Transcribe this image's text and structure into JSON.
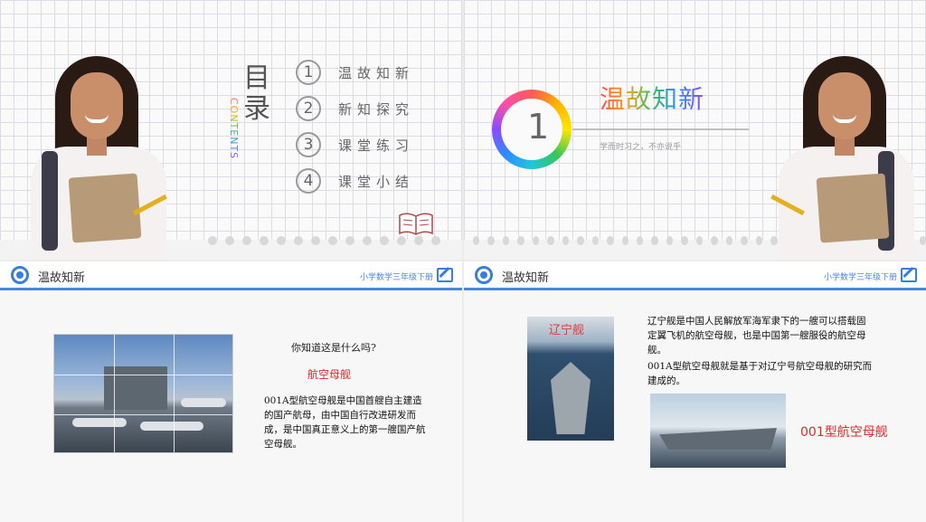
{
  "slide1": {
    "title": "目录",
    "contents_word": "CONTENTS",
    "items": [
      {
        "num": "1",
        "label": "温故知新"
      },
      {
        "num": "2",
        "label": "新知探究"
      },
      {
        "num": "3",
        "label": "课堂练习"
      },
      {
        "num": "4",
        "label": "课堂小结"
      }
    ]
  },
  "slide2": {
    "number": "1",
    "title": "温故知新",
    "subtitle": "学而时习之，不亦说乎"
  },
  "slide3": {
    "header_title": "温故知新",
    "header_right": "小学数学三年级下册",
    "question": "你知道这是什么吗?",
    "answer": "航空母舰",
    "description": "001A型航空母舰是中国首艘自主建造的国产航母，由中国自行改进研发而成，是中国真正意义上的第一艘国产航空母舰。"
  },
  "slide4": {
    "header_title": "温故知新",
    "header_right": "小学数学三年级下册",
    "image1_label": "辽宁舰",
    "paragraph1": "辽宁舰是中国人民解放军海军隶下的一艘可以搭载固定翼飞机的航空母舰，也是中国第一艘服役的航空母舰。",
    "paragraph2": "001A型航空母舰就是基于对辽宁号航空母舰的研究而建成的。",
    "image2_label": "001型航空母舰"
  },
  "colors": {
    "accent": "#3b7ddd",
    "red_text": "#e02b2b"
  },
  "icons": [
    "target-icon",
    "edit-icon",
    "book-icon"
  ]
}
